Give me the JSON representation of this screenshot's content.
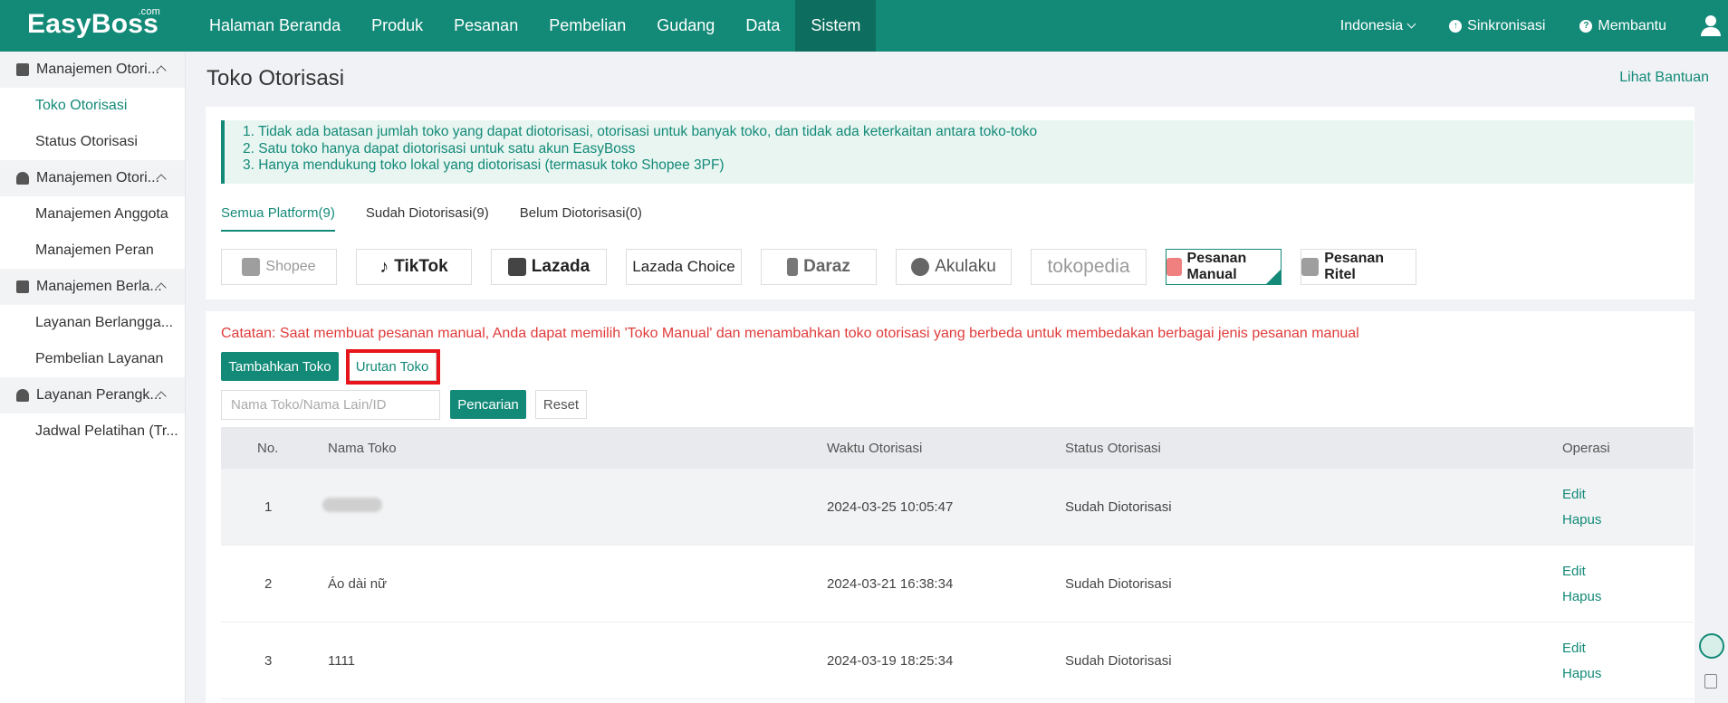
{
  "brand": {
    "name": "EasyBoss",
    "suffix": ".com"
  },
  "nav": {
    "items": [
      "Halaman Beranda",
      "Produk",
      "Pesanan",
      "Pembelian",
      "Gudang",
      "Data",
      "Sistem"
    ],
    "active": "Sistem",
    "language": "Indonesia",
    "sync": "Sinkronisasi",
    "help": "Membantu"
  },
  "sidebar": {
    "groups": [
      {
        "label": "Manajemen Otori...",
        "items": [
          "Toko Otorisasi",
          "Status Otorisasi"
        ]
      },
      {
        "label": "Manajemen Otori...",
        "items": [
          "Manajemen Anggota",
          "Manajemen Peran"
        ]
      },
      {
        "label": "Manajemen Berla...",
        "items": [
          "Layanan Berlangga...",
          "Pembelian Layanan"
        ]
      },
      {
        "label": "Layanan Perangk...",
        "items": [
          "Jadwal Pelatihan (Tr..."
        ]
      }
    ],
    "active_item": "Toko Otorisasi"
  },
  "page": {
    "title": "Toko Otorisasi",
    "help_link": "Lihat Bantuan"
  },
  "notice": {
    "lines": [
      "1. Tidak ada batasan jumlah toko yang dapat diotorisasi, otorisasi untuk banyak toko, dan tidak ada keterkaitan antara toko-toko",
      "2. Satu toko hanya dapat diotorisasi untuk satu akun EasyBoss",
      "3. Hanya mendukung toko lokal yang diotorisasi (termasuk toko Shopee 3PF)"
    ]
  },
  "tabs": [
    {
      "label": "Semua Platform(9)",
      "active": true
    },
    {
      "label": "Sudah Diotorisasi(9)",
      "active": false
    },
    {
      "label": "Belum Diotorisasi(0)",
      "active": false
    }
  ],
  "platforms": [
    {
      "label": "Shopee",
      "icon": "shopee-icon",
      "color": "#999999"
    },
    {
      "label": "TikTok",
      "icon": "tiktok-icon",
      "color": "#111111"
    },
    {
      "label": "Lazada",
      "icon": "lazada-icon",
      "color": "#333333"
    },
    {
      "label": "Lazada Choice",
      "icon": "",
      "color": "#222222"
    },
    {
      "label": "Daraz",
      "icon": "daraz-icon",
      "color": "#666666"
    },
    {
      "label": "Akulaku",
      "icon": "akulaku-icon",
      "color": "#555555"
    },
    {
      "label": "tokopedia",
      "icon": "",
      "color": "#9a9a9a"
    },
    {
      "label": "Pesanan Manual",
      "icon": "manual-order-icon",
      "color": "#f08080",
      "selected": true
    },
    {
      "label": "Pesanan Ritel",
      "icon": "retail-order-icon",
      "color": "#9e9e9e"
    }
  ],
  "note": "Catatan: Saat membuat pesanan manual, Anda dapat memilih 'Toko Manual' dan menambahkan toko otorisasi yang berbeda untuk membedakan berbagai jenis pesanan manual",
  "actions": {
    "add": "Tambahkan Toko",
    "sort": "Urutan Toko"
  },
  "search": {
    "placeholder": "Nama Toko/Nama Lain/ID",
    "button": "Pencarian",
    "reset": "Reset"
  },
  "table": {
    "headers": [
      "No.",
      "Nama Toko",
      "Waktu Otorisasi",
      "Status Otorisasi",
      "Operasi"
    ],
    "rows": [
      {
        "no": "1",
        "name": "",
        "time": "2024-03-25 10:05:47",
        "status": "Sudah Diotorisasi",
        "ops": [
          "Edit",
          "Hapus"
        ]
      },
      {
        "no": "2",
        "name": "Áo dài nữ",
        "time": "2024-03-21 16:38:34",
        "status": "Sudah Diotorisasi",
        "ops": [
          "Edit",
          "Hapus"
        ]
      },
      {
        "no": "3",
        "name": "1111",
        "time": "2024-03-19 18:25:34",
        "status": "Sudah Diotorisasi",
        "ops": [
          "Edit",
          "Hapus"
        ]
      }
    ]
  },
  "colors": {
    "primary": "#138a78",
    "alert": "#e03b3b",
    "highlight": "#e8141c"
  }
}
